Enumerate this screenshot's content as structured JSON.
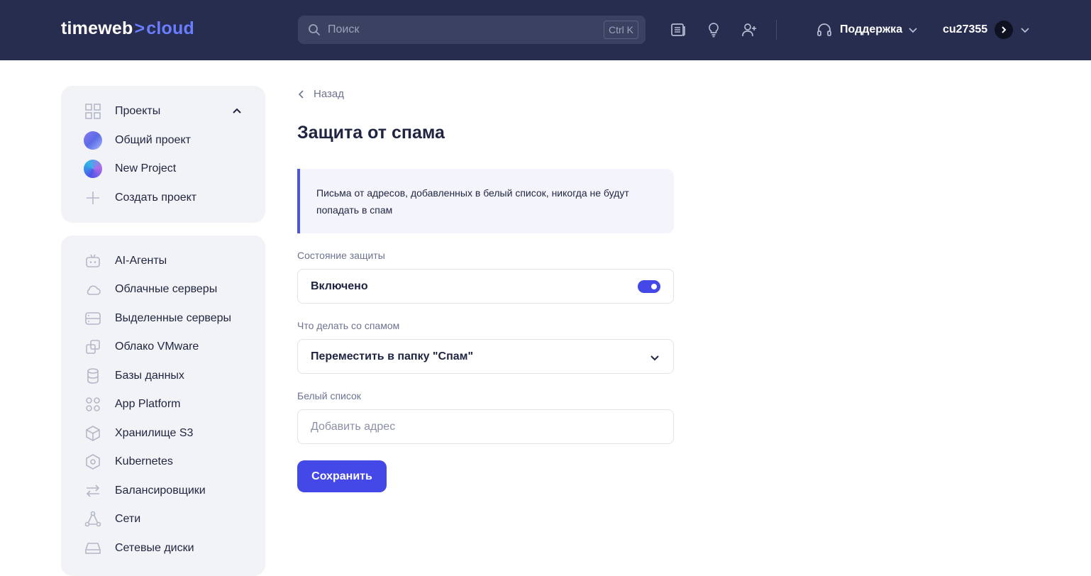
{
  "header": {
    "logo_main": "timeweb",
    "logo_sep": ">",
    "logo_accent": "cloud",
    "search_placeholder": "Поиск",
    "search_shortcut": "Ctrl K",
    "support_label": "Поддержка",
    "user_name": "cu27355"
  },
  "sidebar": {
    "projects_label": "Проекты",
    "projects": [
      {
        "label": "Общий проект"
      },
      {
        "label": "New Project"
      },
      {
        "label": "Создать проект"
      }
    ],
    "nav": [
      {
        "label": "AI-Агенты",
        "icon": "robot-icon"
      },
      {
        "label": "Облачные серверы",
        "icon": "cloud-icon"
      },
      {
        "label": "Выделенные серверы",
        "icon": "server-icon"
      },
      {
        "label": "Облако VMware",
        "icon": "vmware-icon"
      },
      {
        "label": "Базы данных",
        "icon": "database-icon"
      },
      {
        "label": "App Platform",
        "icon": "apps-icon"
      },
      {
        "label": "Хранилище S3",
        "icon": "cube-icon"
      },
      {
        "label": "Kubernetes",
        "icon": "kubernetes-icon"
      },
      {
        "label": "Балансировщики",
        "icon": "arrows-icon"
      },
      {
        "label": "Сети",
        "icon": "network-icon"
      },
      {
        "label": "Сетевые диски",
        "icon": "disk-icon"
      }
    ]
  },
  "main": {
    "back_label": "Назад",
    "title": "Защита от спама",
    "notice": "Письма от адресов, добавленных в белый список, никогда не будут попадать в спам",
    "protection_label": "Состояние защиты",
    "protection_value": "Включено",
    "protection_enabled": true,
    "spam_action_label": "Что делать со спамом",
    "spam_action_value": "Переместить в папку \"Спам\"",
    "whitelist_label": "Белый список",
    "whitelist_placeholder": "Добавить адрес",
    "save_label": "Сохранить"
  },
  "colors": {
    "header_bg": "#262d4e",
    "accent": "#4448e6",
    "logo_accent": "#6a7dff",
    "sidebar_bg": "#f2f3f6"
  }
}
